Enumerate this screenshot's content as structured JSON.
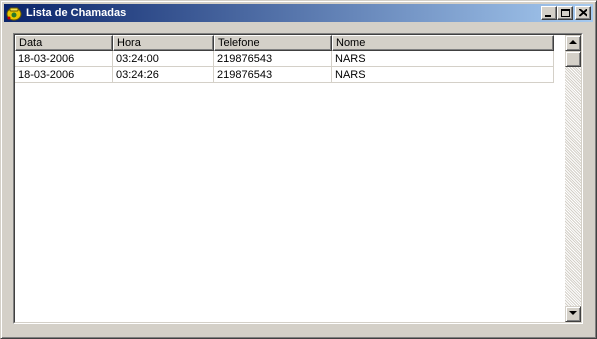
{
  "window": {
    "title": "Lista de Chamadas",
    "icon": "phone-app-icon",
    "controls": [
      "minimize-icon",
      "maximize-icon",
      "close-icon"
    ]
  },
  "table": {
    "columns": [
      "Data",
      "Hora",
      "Telefone",
      "Nome"
    ],
    "rows": [
      [
        "18-03-2006",
        "03:24:00",
        "219876543",
        "NARS"
      ],
      [
        "18-03-2006",
        "03:24:26",
        "219876543",
        "NARS"
      ]
    ]
  },
  "colors": {
    "titlebar_start": "#0a246a",
    "titlebar_end": "#a6caf0",
    "face": "#d4d0c8"
  }
}
